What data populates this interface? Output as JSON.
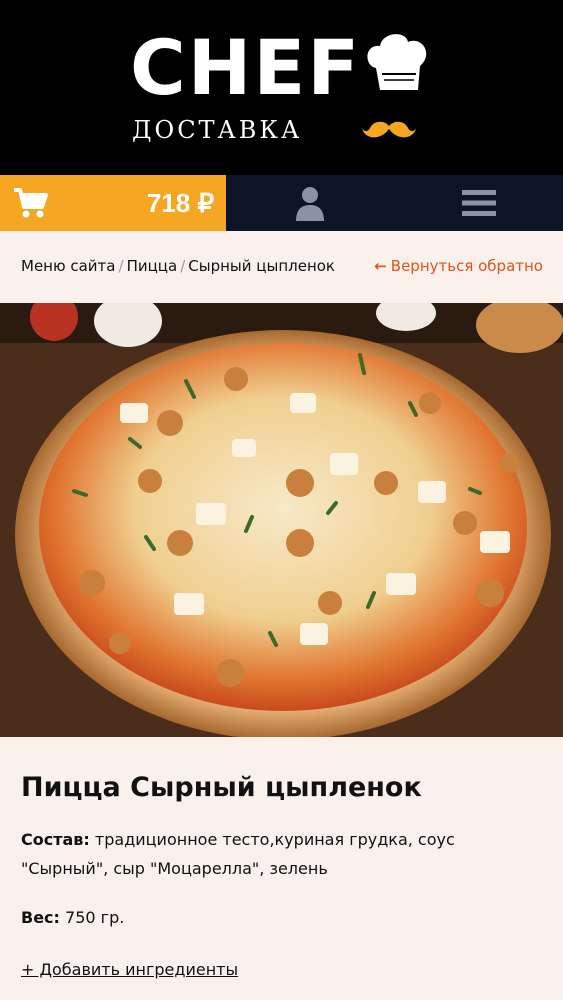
{
  "header": {
    "logo_text": "CHEF",
    "logo_subtitle": "ДОСТАВКА"
  },
  "navbar": {
    "cart_total": "718 ₽",
    "accent_color": "#f5a623",
    "nav_bg_color": "#0c1528",
    "icons": [
      "cart-icon",
      "user-icon",
      "menu-icon"
    ]
  },
  "breadcrumb": {
    "items": [
      "Меню сайта",
      "Пицца",
      "Сырный цыпленок"
    ],
    "separator": "/",
    "back_label": "Вернуться обратно",
    "back_color": "#e5501c"
  },
  "product": {
    "title": "Пицца Сырный цыпленок",
    "composition_label": "Состав:",
    "composition": "традиционное тесто,куриная грудка, соус \"Сырный\", сыр \"Моцарелла\", зелень",
    "weight_label": "Вес:",
    "weight": "750 гр.",
    "add_ingredients": "+ Добавить ингредиенты"
  }
}
